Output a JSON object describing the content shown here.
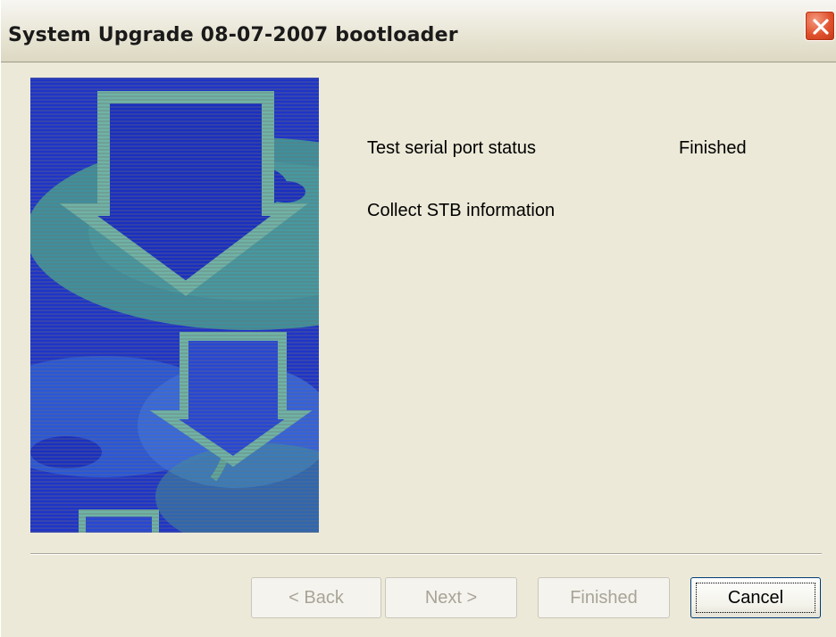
{
  "window": {
    "title": "System Upgrade 08-07-2007 bootloader"
  },
  "status": {
    "rows": [
      {
        "label": "Test serial port status",
        "value": "Finished"
      },
      {
        "label": "Collect STB information",
        "value": ""
      }
    ]
  },
  "buttons": {
    "back": "< Back",
    "next": "Next >",
    "finished": "Finished",
    "cancel": "Cancel"
  },
  "icons": {
    "close": "close-icon",
    "wizard_image": "download-arrows-icon"
  },
  "colors": {
    "image_background": "#1a2fc0",
    "image_accent": "#5fa69a",
    "close_button": "#e0512c"
  }
}
